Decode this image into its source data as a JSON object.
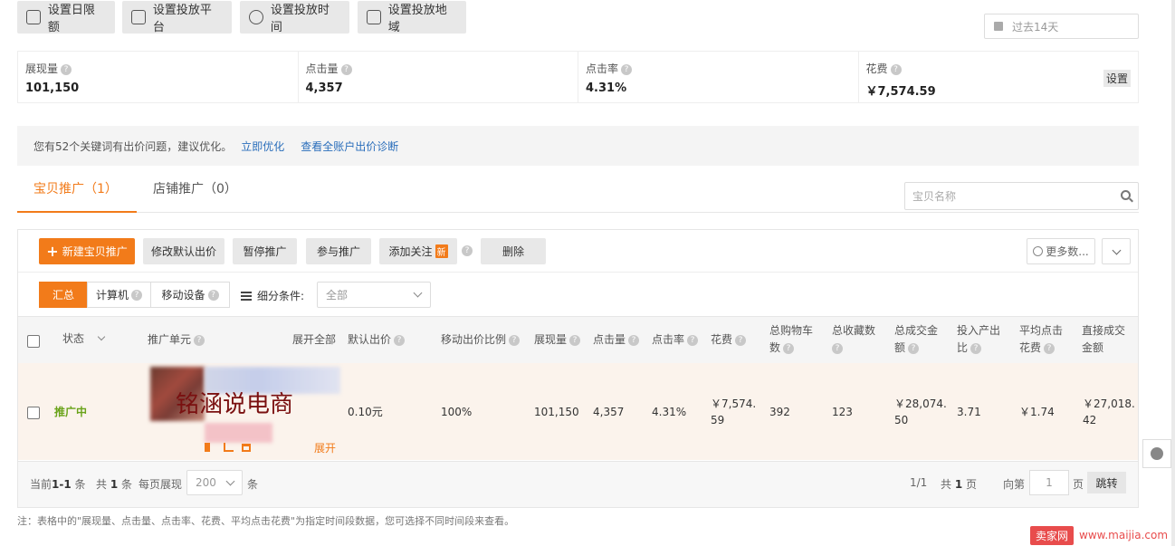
{
  "top_buttons": [
    "设置日限额",
    "设置投放平台",
    "设置投放时间",
    "设置投放地域"
  ],
  "date_range": "过去14天",
  "stats": [
    {
      "label": "展现量",
      "value": "101,150"
    },
    {
      "label": "点击量",
      "value": "4,357"
    },
    {
      "label": "点击率",
      "value": "4.31%"
    },
    {
      "label": "花费",
      "value": "￥7,574.59"
    }
  ],
  "settings_label": "设置",
  "notice": {
    "text": "您有52个关键词有出价问题，建议优化。",
    "link1": "立即优化",
    "link2": "查看全账户出价诊断"
  },
  "tabs": [
    "宝贝推广（1）",
    "店铺推广（0）"
  ],
  "search_placeholder": "宝贝名称",
  "toolbar": {
    "new": "新建宝贝推广",
    "modify_bid": "修改默认出价",
    "pause": "暂停推广",
    "join": "参与推广",
    "follow": "添加关注",
    "new_badge": "新",
    "delete": "删除",
    "more": "更多数..."
  },
  "segments": [
    "汇总",
    "计算机",
    "移动设备"
  ],
  "filter": {
    "label": "细分条件:",
    "value": "全部"
  },
  "columns": {
    "status": "状态",
    "unit": "推广单元",
    "expand_all": "展开全部",
    "default_bid": "默认出价",
    "mobile_ratio": "移动出价比例",
    "impressions": "展现量",
    "clicks": "点击量",
    "ctr": "点击率",
    "cost": "花费",
    "cart_line1": "总购物车",
    "cart_line2": "数",
    "fav": "总收藏数",
    "gmv_line1": "总成交金",
    "gmv_line2": "额",
    "roi_line1": "投入产出",
    "roi_line2": "比",
    "cpc_line1": "平均点击",
    "cpc_line2": "花费",
    "direct_line1": "直接成交",
    "direct_line2": "金额"
  },
  "row": {
    "status": "推广中",
    "watermark": "铭涵说电商",
    "expand": "展开",
    "default_bid": "0.10元",
    "mobile_ratio": "100%",
    "impressions": "101,150",
    "clicks": "4,357",
    "ctr": "4.31%",
    "cost_line1": "￥7,574.",
    "cost_line2": "59",
    "cart": "392",
    "fav": "123",
    "gmv_line1": "￥28,074.",
    "gmv_line2": "50",
    "roi": "3.71",
    "cpc": "￥1.74",
    "direct_line1": "￥27,018.",
    "direct_line2": "42"
  },
  "footer": {
    "current_prefix": "当前",
    "current_range": "1-1",
    "current_suffix": "条",
    "total_prefix": "共",
    "total_count": "1",
    "total_suffix": "条",
    "per_page_label": "每页展现",
    "per_page_value": "200",
    "per_page_suffix": "条",
    "page_info": "1/1",
    "total_pages_prefix": "共",
    "total_pages": "1",
    "total_pages_suffix": "页",
    "goto_label": "向第",
    "goto_placeholder": "1",
    "goto_suffix": "页",
    "jump": "跳转"
  },
  "note": "注：表格中的\"展现量、点击量、点击率、花费、平均点击花费\"为指定时间段数据，您可选择不同时间段来查看。",
  "watermark_site": {
    "tag": "卖家网",
    "url": "www.maijia.com"
  },
  "colors": {
    "accent": "#f27b1a",
    "link": "#2a6ebb",
    "status_green": "#6aa31a",
    "row_bg": "#fbf3ec"
  }
}
